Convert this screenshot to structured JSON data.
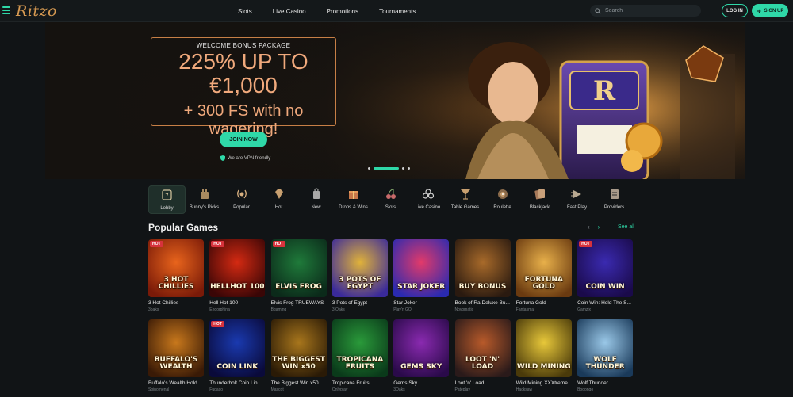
{
  "header": {
    "logo": "Ritzo",
    "nav": [
      "Slots",
      "Live Casino",
      "Promotions",
      "Tournaments"
    ],
    "search_placeholder": "Search",
    "login_label": "LOG IN",
    "signup_label": "SIGN UP"
  },
  "hero": {
    "bonus_small": "WELCOME BONUS PACKAGE",
    "bonus_line1": "225% UP TO",
    "bonus_line2": "€1,000",
    "bonus_line3": "+ 300 FS with no wagering!",
    "join_label": "JOIN NOW",
    "vpn_note": "We are VPN friendly",
    "slides_total": 3,
    "slide_active": 1
  },
  "categories": [
    {
      "label": "Lobby",
      "icon": "lobby-slot-icon",
      "active": true
    },
    {
      "label": "Bunny's Picks",
      "icon": "bunny-icon"
    },
    {
      "label": "Popular",
      "icon": "laurel-icon"
    },
    {
      "label": "Hot",
      "icon": "diamond-icon"
    },
    {
      "label": "New",
      "icon": "tag-icon"
    },
    {
      "label": "Drops & Wins",
      "icon": "gift-icon"
    },
    {
      "label": "Slots",
      "icon": "cherries-icon"
    },
    {
      "label": "Live Casino",
      "icon": "clubs-icon"
    },
    {
      "label": "Table Games",
      "icon": "cocktail-icon"
    },
    {
      "label": "Roulette",
      "icon": "roulette-icon"
    },
    {
      "label": "Blackjack",
      "icon": "cards-icon"
    },
    {
      "label": "Fast Play",
      "icon": "fast-play-icon"
    },
    {
      "label": "Providers",
      "icon": "providers-icon"
    }
  ],
  "popular": {
    "title": "Popular Games",
    "see_all": "See all",
    "prev_arrow": "‹",
    "next_arrow": "›",
    "hot_badge": "HOT",
    "games": [
      {
        "name": "3 Hot Chillies",
        "provider": "3oaks",
        "art_text": "3 HOT CHILLIES",
        "hot": true,
        "c1": "#e8641c",
        "c2": "#7a1a08"
      },
      {
        "name": "Hell Hot 100",
        "provider": "Endorphina",
        "art_text": "HELLHOT 100",
        "hot": true,
        "c1": "#d42a12",
        "c2": "#3a0606"
      },
      {
        "name": "Elvis Frog TRUEWAYS",
        "provider": "Bgaming",
        "art_text": "ELVIS FROG",
        "hot": true,
        "c1": "#1f7a3a",
        "c2": "#0b2a1a"
      },
      {
        "name": "3 Pots of Egypt",
        "provider": "3 Oaks",
        "art_text": "3 POTS OF EGYPT",
        "hot": false,
        "c1": "#e0b23a",
        "c2": "#3a2a9a"
      },
      {
        "name": "Star Joker",
        "provider": "Play'n GO",
        "art_text": "STAR JOKER",
        "hot": false,
        "c1": "#e23a6a",
        "c2": "#2a2ab0"
      },
      {
        "name": "Book of Ra Deluxe Bu...",
        "provider": "Novomatic",
        "art_text": "BUY BONUS",
        "hot": false,
        "c1": "#a86a2a",
        "c2": "#2a1a10"
      },
      {
        "name": "Fortuna Gold",
        "provider": "Fantasma",
        "art_text": "FORTUNA GOLD",
        "hot": false,
        "c1": "#e8b04a",
        "c2": "#6a3a10"
      },
      {
        "name": "Coin Win: Hold The S...",
        "provider": "Gamzix",
        "art_text": "COIN WIN",
        "hot": true,
        "c1": "#3a2ab0",
        "c2": "#1a0a4a"
      },
      {
        "name": "Buffalo's Wealth Hold ...",
        "provider": "Spinomenal",
        "art_text": "BUFFALO'S WEALTH",
        "hot": false,
        "c1": "#c8781c",
        "c2": "#3a1a06"
      },
      {
        "name": "Thunderbolt Coin Lin...",
        "provider": "Fugaso",
        "art_text": "COIN LINK",
        "hot": true,
        "c1": "#1a3ab0",
        "c2": "#0a0a3a"
      },
      {
        "name": "The Biggest Win x50",
        "provider": "Mascot",
        "art_text": "THE BIGGEST WIN x50",
        "hot": false,
        "c1": "#a8761c",
        "c2": "#2a1a06"
      },
      {
        "name": "Tropicana Fruits",
        "provider": "Onlyplay",
        "art_text": "TROPICANA FRUITS",
        "hot": false,
        "c1": "#2a9a3a",
        "c2": "#0a3a1a"
      },
      {
        "name": "Gems Sky",
        "provider": "3Oaks",
        "art_text": "GEMS SKY",
        "hot": false,
        "c1": "#8a2ab0",
        "c2": "#2a0a4a"
      },
      {
        "name": "Loot 'n' Load",
        "provider": "Pateplay",
        "art_text": "LOOT 'N' LOAD",
        "hot": false,
        "c1": "#b85a2a",
        "c2": "#2a1a1a"
      },
      {
        "name": "Wild Mining XXXtreme",
        "provider": "Hacksaw",
        "art_text": "WILD MINING",
        "hot": false,
        "c1": "#e8c83a",
        "c2": "#4a3a0a"
      },
      {
        "name": "Wolf Thunder",
        "provider": "Booongo",
        "art_text": "WOLF THUNDER",
        "hot": false,
        "c1": "#9ac8e8",
        "c2": "#1a3a5a"
      }
    ]
  },
  "colors": {
    "accent": "#2fd8a8",
    "bonus_text": "#f0a97c",
    "bonus_border": "#c77f46",
    "logo": "#d79a52",
    "hot_badge": "#d6323c"
  }
}
